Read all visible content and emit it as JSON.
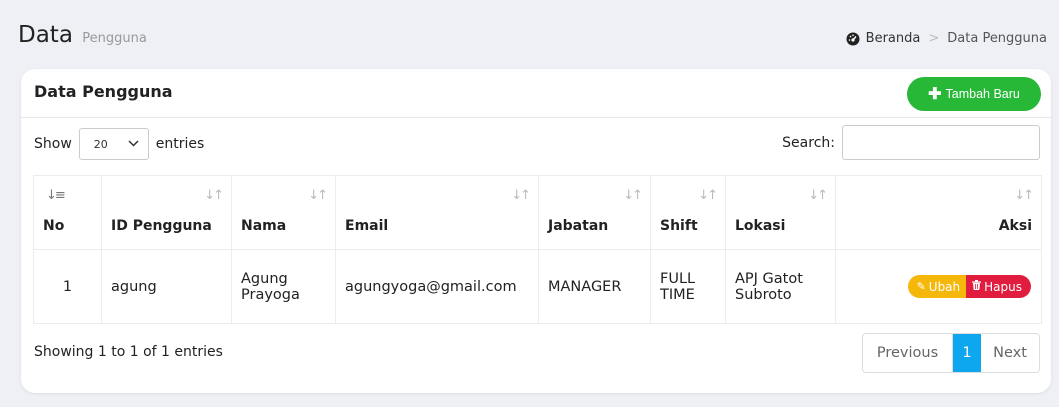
{
  "header": {
    "title": "Data",
    "subtitle": "Pengguna",
    "breadcrumb": {
      "home_label": "Beranda",
      "separator": ">",
      "current_label": "Data Pengguna",
      "home_icon": "dashboard-icon"
    }
  },
  "card": {
    "title": "Data Pengguna",
    "add_button_label": "Tambah Baru",
    "add_button_icon": "plus-icon",
    "add_button_color": "#28b837"
  },
  "controls": {
    "show_label": "Show",
    "entries_value": "20",
    "entries_label": "entries",
    "search_label": "Search:",
    "search_value": ""
  },
  "table": {
    "columns": [
      "No",
      "ID Pengguna",
      "Nama",
      "Email",
      "Jabatan",
      "Shift",
      "Lokasi",
      "Aksi"
    ],
    "rows": [
      {
        "no": "1",
        "id_pengguna": "agung",
        "nama": "Agung Prayoga",
        "email": "agungyoga@gmail.com",
        "jabatan": "MANAGER",
        "shift": "FULL TIME",
        "lokasi": "APJ Gatot Subroto",
        "edit_label": "Ubah",
        "delete_label": "Hapus"
      }
    ]
  },
  "footer": {
    "info": "Showing 1 to 1 of 1 entries",
    "pagination": {
      "previous_label": "Previous",
      "current_page": "1",
      "next_label": "Next"
    }
  },
  "colors": {
    "edit": "#f6b70b",
    "delete": "#e11d3f",
    "active_page": "#0ca7ee"
  }
}
